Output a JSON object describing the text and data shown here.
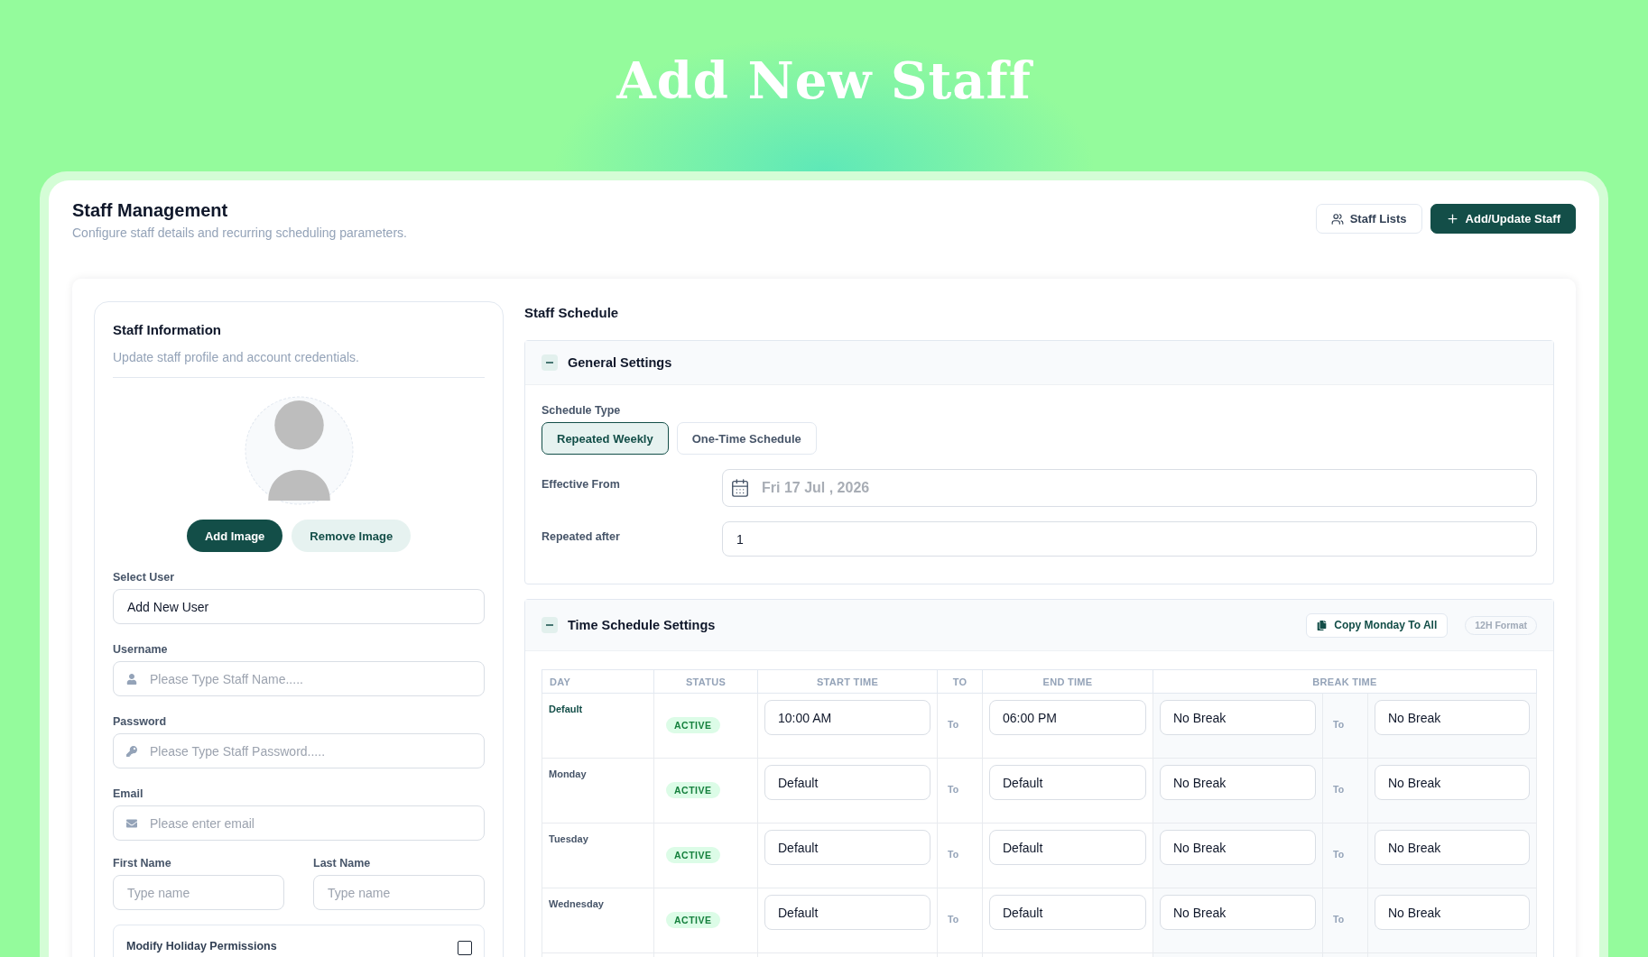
{
  "hero": {
    "title": "Add New Staff"
  },
  "header": {
    "title": "Staff Management",
    "subtitle": "Configure staff details and recurring scheduling parameters.",
    "buttons": [
      {
        "label": "Staff Lists",
        "kind": "secondary"
      },
      {
        "label": "Add/Update Staff",
        "kind": "primary"
      }
    ]
  },
  "staff_information": {
    "title": "Staff Information",
    "subtitle": "Update staff profile and account credentials.",
    "image_buttons": [
      {
        "label": "Add Image",
        "kind": "primary"
      },
      {
        "label": "Remove Image",
        "kind": "secondary"
      }
    ],
    "fields": [
      {
        "label": "Select User",
        "kind": "select",
        "value": "Add New User"
      },
      {
        "label": "Username",
        "kind": "user",
        "placeholder": "Please Type Staff Name....."
      },
      {
        "label": "Password",
        "kind": "password",
        "placeholder": "Please Type Staff Password....."
      },
      {
        "label": "Email",
        "kind": "email",
        "placeholder": "Please enter email"
      }
    ],
    "name_fields": [
      {
        "label": "First Name",
        "placeholder": "Type name"
      },
      {
        "label": "Last Name",
        "placeholder": "Type name"
      }
    ],
    "holiday_permissions": {
      "label": "Modify Holiday Permissions",
      "checked": false
    }
  },
  "staff_schedule": {
    "title": "Staff Schedule",
    "general_settings": {
      "title": "General Settings",
      "expanded": true,
      "schedule_type": {
        "label": "Schedule Type",
        "options": [
          {
            "label": "Repeated Weekly",
            "selected": true
          },
          {
            "label": "One-Time Schedule",
            "selected": false
          }
        ]
      },
      "effective_from": {
        "label": "Effective From",
        "placeholder": "Fri 17 Jul , 2026"
      },
      "repeated_after": {
        "label": "Repeated after",
        "value": "1"
      }
    },
    "time_schedule": {
      "title": "Time Schedule Settings",
      "expanded": true,
      "copy_button": "Copy Monday To All",
      "format_badge": "12H Format",
      "columns": [
        "DAY",
        "STATUS",
        "START TIME",
        "TO",
        "END TIME",
        "BREAK TIME"
      ],
      "rows": [
        {
          "day": "Default",
          "kind": "default",
          "status": "ACTIVE",
          "start_time": "10:00 AM",
          "to_1": "To",
          "end_time": "06:00 PM",
          "break_start": "No Break",
          "to_2": "To",
          "break_end": "No Break"
        },
        {
          "day": "Monday",
          "kind": "day",
          "status": "ACTIVE",
          "start_time": "Default",
          "to_1": "To",
          "end_time": "Default",
          "break_start": "No Break",
          "to_2": "To",
          "break_end": "No Break"
        },
        {
          "day": "Tuesday",
          "kind": "day",
          "status": "ACTIVE",
          "start_time": "Default",
          "to_1": "To",
          "end_time": "Default",
          "break_start": "No Break",
          "to_2": "To",
          "break_end": "No Break"
        },
        {
          "day": "Wednesday",
          "kind": "day",
          "status": "ACTIVE",
          "start_time": "Default",
          "to_1": "To",
          "end_time": "Default",
          "break_start": "No Break",
          "to_2": "To",
          "break_end": "No Break"
        }
      ]
    }
  }
}
